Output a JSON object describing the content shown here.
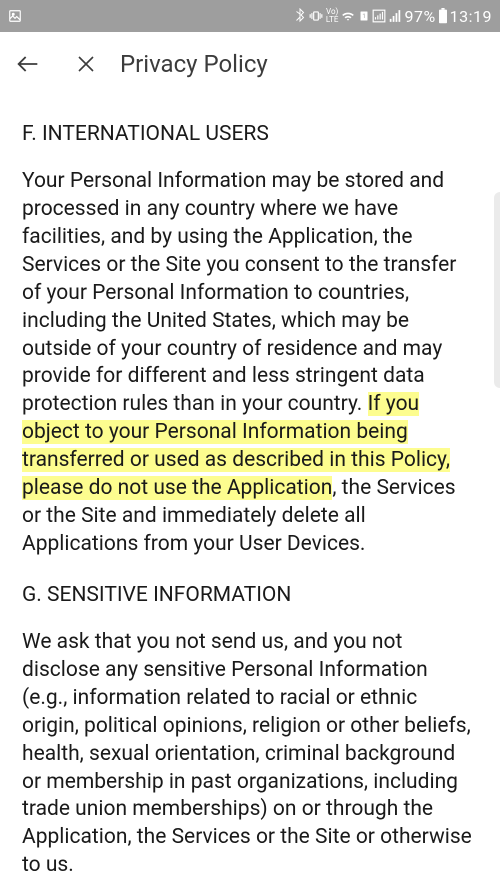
{
  "status_bar": {
    "battery_pct": "97%",
    "time": "13:19",
    "volte_top": "Vo)",
    "volte_bot": "LTE"
  },
  "app_bar": {
    "title": "Privacy Policy"
  },
  "sections": {
    "f_heading": "F. INTERNATIONAL USERS",
    "f_para_pre": "Your Personal Information may be stored and processed in any country where we have facilities, and by using the Application, the Services or the Site you consent to the transfer of your Personal Information to countries, including the United States, which may be outside of your country of residence and may provide for different and less stringent data protection rules than in your country. ",
    "f_para_hl": "If you object to your Personal Information being transferred or used as described in this Policy, please do not use the Application",
    "f_para_post": ", the Services or the Site and immediately delete all Applications from your User Devices.",
    "g_heading": "G. SENSITIVE INFORMATION",
    "g_para": "We ask that you not send us, and you not disclose any sensitive Personal Information (e.g., information related to racial or ethnic origin, political opinions, religion or other beliefs, health, sexual orientation, criminal background or membership in past organizations, including trade union memberships) on or through the Application, the Services or the Site or otherwise to us."
  }
}
